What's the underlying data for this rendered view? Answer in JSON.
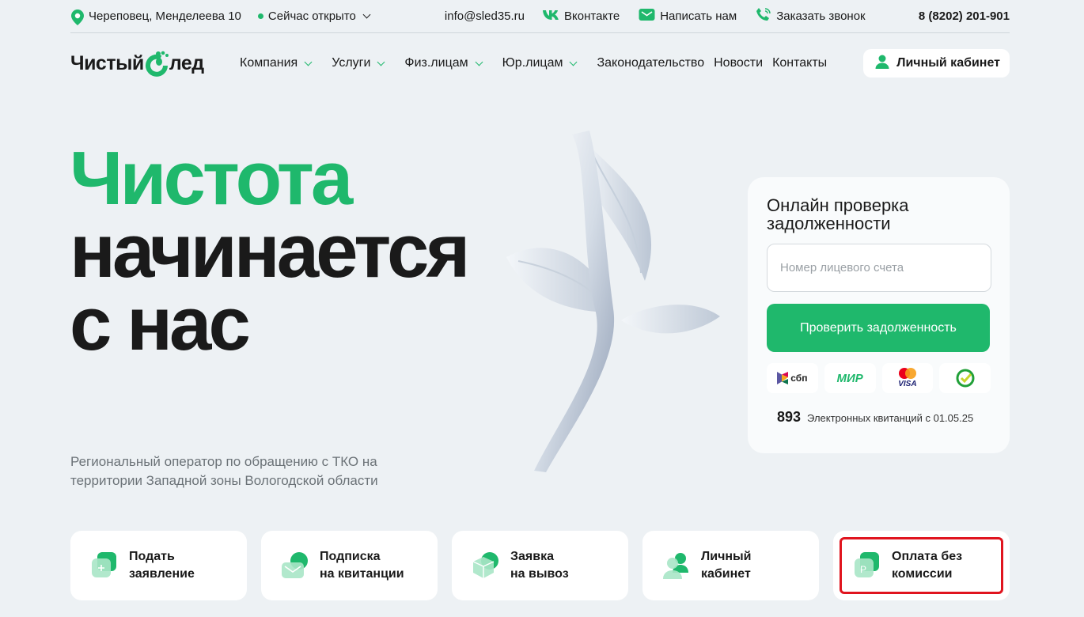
{
  "topbar": {
    "address": "Череповец, Менделеева 10",
    "status": "Сейчас открыто",
    "email": "info@sled35.ru",
    "vk": "Вконтакте",
    "write": "Написать нам",
    "callback": "Заказать звонок",
    "phone": "8 (8202) 201-901"
  },
  "nav": {
    "logo_a": "Чистый",
    "logo_b": "лед",
    "items": [
      {
        "label": "Компания"
      },
      {
        "label": "Услуги"
      },
      {
        "label": "Физ.лицам"
      },
      {
        "label": "Юр.лицам"
      },
      {
        "label": "Законодательство"
      },
      {
        "label": "Новости"
      },
      {
        "label": "Контакты"
      }
    ],
    "cabinet": "Личный кабинет"
  },
  "hero": {
    "line1": "Чистота",
    "line2": "начинается",
    "line3": "с нас",
    "subtitle": "Региональный оператор по обращению с ТКО на территории Западной зоны Вологодской области"
  },
  "debt": {
    "title": "Онлайн проверка задолженности",
    "placeholder": "Номер лицевого счета",
    "button": "Проверить задолженность",
    "pay": [
      "сбп",
      "МИР",
      "VISA",
      "✓"
    ],
    "receipts_count": "893",
    "receipts_text": "Электронных квитанций с 01.05.25"
  },
  "tiles": [
    {
      "label": "Подать\nзаявление"
    },
    {
      "label": "Подписка\nна квитанции"
    },
    {
      "label": "Заявка\nна вывоз"
    },
    {
      "label": "Личный\nкабинет"
    },
    {
      "label": "Оплата без\nкомиссии"
    }
  ],
  "colors": {
    "accent": "#1fb86c",
    "highlight": "#e0141e"
  }
}
